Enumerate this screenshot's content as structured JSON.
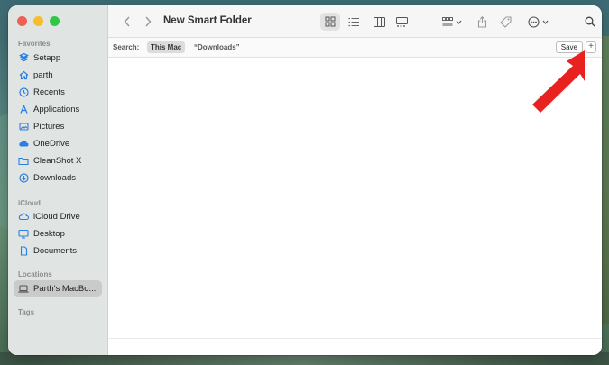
{
  "window": {
    "title": "New Smart Folder"
  },
  "sidebar": {
    "favorites_title": "Favorites",
    "favorites": [
      {
        "label": "Setapp",
        "icon": "setapp-icon"
      },
      {
        "label": "parth",
        "icon": "home-icon"
      },
      {
        "label": "Recents",
        "icon": "clock-icon"
      },
      {
        "label": "Applications",
        "icon": "applications-icon"
      },
      {
        "label": "Pictures",
        "icon": "pictures-icon"
      },
      {
        "label": "OneDrive",
        "icon": "cloud-icon"
      },
      {
        "label": "CleanShot X",
        "icon": "folder-icon"
      },
      {
        "label": "Downloads",
        "icon": "download-icon"
      }
    ],
    "icloud_title": "iCloud",
    "icloud": [
      {
        "label": "iCloud Drive",
        "icon": "icloud-icon"
      },
      {
        "label": "Desktop",
        "icon": "desktop-icon"
      },
      {
        "label": "Documents",
        "icon": "document-icon"
      }
    ],
    "locations_title": "Locations",
    "locations": [
      {
        "label": "Parth's MacBo...",
        "icon": "laptop-icon",
        "selected": true
      }
    ],
    "tags_title": "Tags"
  },
  "search": {
    "label": "Search:",
    "scope_this_mac": "This Mac",
    "scope_downloads": "“Downloads”",
    "save_label": "Save",
    "add_label": "+"
  },
  "colors": {
    "accent_blue": "#2a7fe0",
    "arrow_red": "#e8231f"
  }
}
